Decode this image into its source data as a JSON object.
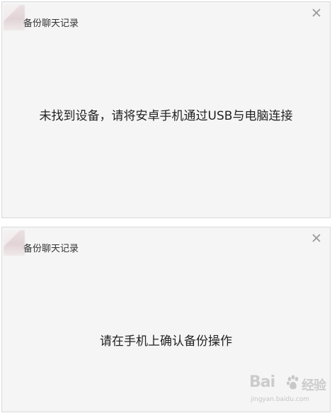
{
  "dialogs": [
    {
      "title": "备份聊天记录",
      "message": "未找到设备，请将安卓手机通过USB与电脑连接"
    },
    {
      "title": "备份聊天记录",
      "message": "请在手机上确认备份操作"
    }
  ],
  "icons": {
    "close": "close-icon",
    "logo": "app-logo-icon",
    "watermark": "baidu-paw-icon"
  },
  "watermark": {
    "brand_left": "Bai",
    "brand_right": "经验",
    "url": "jingyan.baidu.com"
  },
  "colors": {
    "dialog_background": "#f5f5f5",
    "dialog_border": "#d9d9d9",
    "text": "#222222",
    "close_icon": "#9a9a9a"
  }
}
